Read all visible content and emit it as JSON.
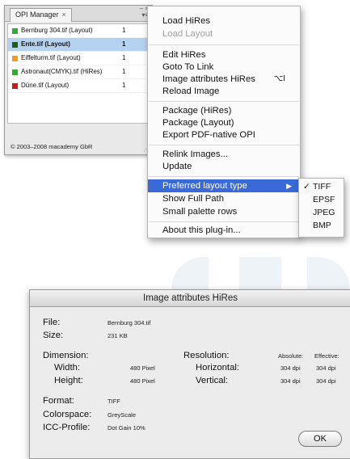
{
  "palette": {
    "tab_title": "OPI Manager",
    "tab_close": "×",
    "window_controls": "– ×",
    "menu_glyph": "▾≡",
    "rows": [
      {
        "name": "Bernburg 304.tif (Layout)",
        "count": "1",
        "color": "#2fae2f",
        "selected": false
      },
      {
        "name": "Ente.tif (Layout)",
        "count": "1",
        "color": "#1f5a1f",
        "selected": true
      },
      {
        "name": "Eiffelturm.tif (Layout)",
        "count": "1",
        "color": "#f39c1e",
        "selected": false
      },
      {
        "name": "Astronaut(CMYK).tif (HiRes)",
        "count": "1",
        "color": "#2fae2f",
        "selected": false
      },
      {
        "name": "Düne.tif (Layout)",
        "count": "1",
        "color": "#d01818",
        "selected": false
      }
    ],
    "copyright": "© 2003–2008 macademy GbR"
  },
  "menu": {
    "load_hires": "Load HiRes",
    "load_layout": "Load Layout",
    "edit_hires": "Edit HiRes",
    "goto_link": "Goto To Link",
    "image_attributes": "Image attributes HiRes",
    "image_attributes_shortcut": "⌥I",
    "reload_image": "Reload Image",
    "package_hires": "Package (HiRes)",
    "package_layout": "Package (Layout)",
    "export_pdf": "Export PDF-native OPI",
    "relink_images": "Relink Images...",
    "update": "Update",
    "preferred_layout_type": "Preferred layout type",
    "submenu_arrow": "▶",
    "show_full_path": "Show Full Path",
    "small_palette_rows": "Small palette rows",
    "about": "About this plug-in..."
  },
  "submenu": {
    "checkmark": "✓",
    "items": [
      "TIFF",
      "EPSF",
      "JPEG",
      "BMP"
    ],
    "checked": "TIFF"
  },
  "dialog": {
    "title": "Image attributes HiRes",
    "file_label": "File:",
    "file_value": "Bernburg 304.tif",
    "size_label": "Size:",
    "size_value": "231 KB",
    "dimension_label": "Dimension:",
    "width_label": "Width:",
    "width_value": "480 Pixel",
    "height_label": "Height:",
    "height_value": "480 Pixel",
    "resolution_label": "Resolution:",
    "absolute_label": "Absolute:",
    "effective_label": "Effective:",
    "horizontal_label": "Horizontal:",
    "horizontal_absolute": "304 dpi",
    "horizontal_effective": "304 dpi",
    "vertical_label": "Vertical:",
    "vertical_absolute": "304 dpi",
    "vertical_effective": "304 dpi",
    "format_label": "Format:",
    "format_value": "TIFF",
    "colorspace_label": "Colorspace:",
    "colorspace_value": "GreyScale",
    "icc_label": "ICC-Profile:",
    "icc_value": "Dot Gain 10%",
    "ok_label": "OK"
  },
  "colors": {
    "menu_highlight": "#3a6ad8",
    "row_selected": "#b5d2f1"
  }
}
